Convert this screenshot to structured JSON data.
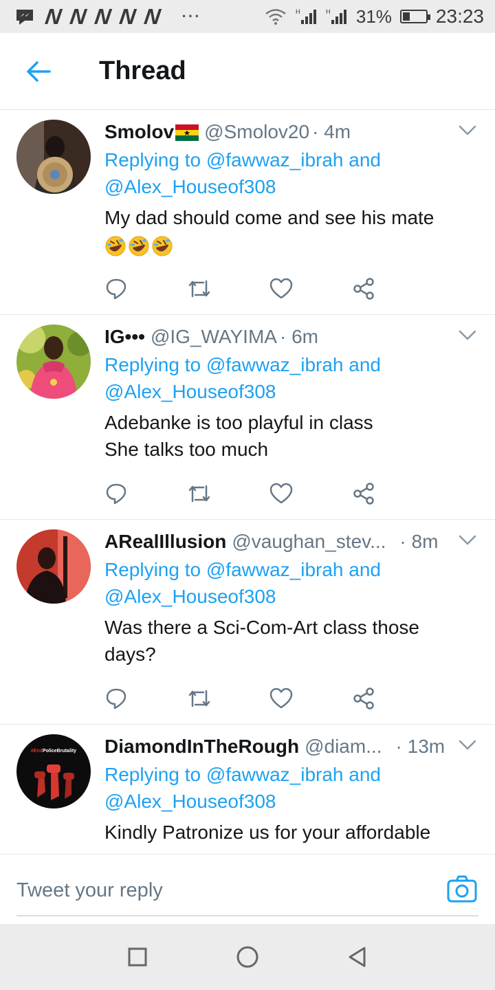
{
  "status_bar": {
    "notification_letters": [
      "N",
      "N",
      "N",
      "N",
      "N"
    ],
    "more_dots": "···",
    "battery": "31%",
    "battery_level": 0.31,
    "time": "23:23"
  },
  "header": {
    "title": "Thread"
  },
  "tweets": [
    {
      "name": "Smolov",
      "flag": "ghana-flag",
      "handle": "@Smolov20",
      "time": "· 4m",
      "replying_prefix": "Replying to",
      "mention_1": "@fawwaz_ibrah",
      "and_word": "and",
      "mention_2": "@Alex_Houseof308",
      "text_line_1": "My dad should come and see his mate",
      "text_line_2": "",
      "emojis": [
        "rolling-on-floor-laughing",
        "rolling-on-floor-laughing",
        "rolling-on-floor-laughing"
      ]
    },
    {
      "name": "IG•••",
      "handle": "@IG_WAYIMA",
      "time": "· 6m",
      "replying_prefix": "Replying to",
      "mention_1": "@fawwaz_ibrah",
      "and_word": "and",
      "mention_2": "@Alex_Houseof308",
      "text_line_1": "Adebanke is too playful in class",
      "text_line_2": "She talks too much"
    },
    {
      "name": "ARealIllusion",
      "handle": "@vaughan_stev...",
      "time": "· 8m",
      "replying_prefix": "Replying to",
      "mention_1": "@fawwaz_ibrah",
      "and_word": "and",
      "mention_2": "@Alex_Houseof308",
      "text_line_1": "Was there a Sci-Com-Art class those",
      "text_line_2": "days?"
    },
    {
      "name": "DiamondInTheRough",
      "handle": "@diam...",
      "time": "· 13m",
      "replying_prefix": "Replying to",
      "mention_1": "@fawwaz_ibrah",
      "and_word": "and",
      "mention_2": "@Alex_Houseof308",
      "text_line_1": "Kindly Patronize us for your affordable",
      "text_line_2": "",
      "avatar_text": "#EndPoliceBrutality"
    }
  ],
  "reply_bar": {
    "placeholder": "Tweet your reply"
  },
  "colors": {
    "accent": "#1da1f2",
    "muted": "#657786",
    "text": "#14171a",
    "divider": "#e1e8ed"
  }
}
